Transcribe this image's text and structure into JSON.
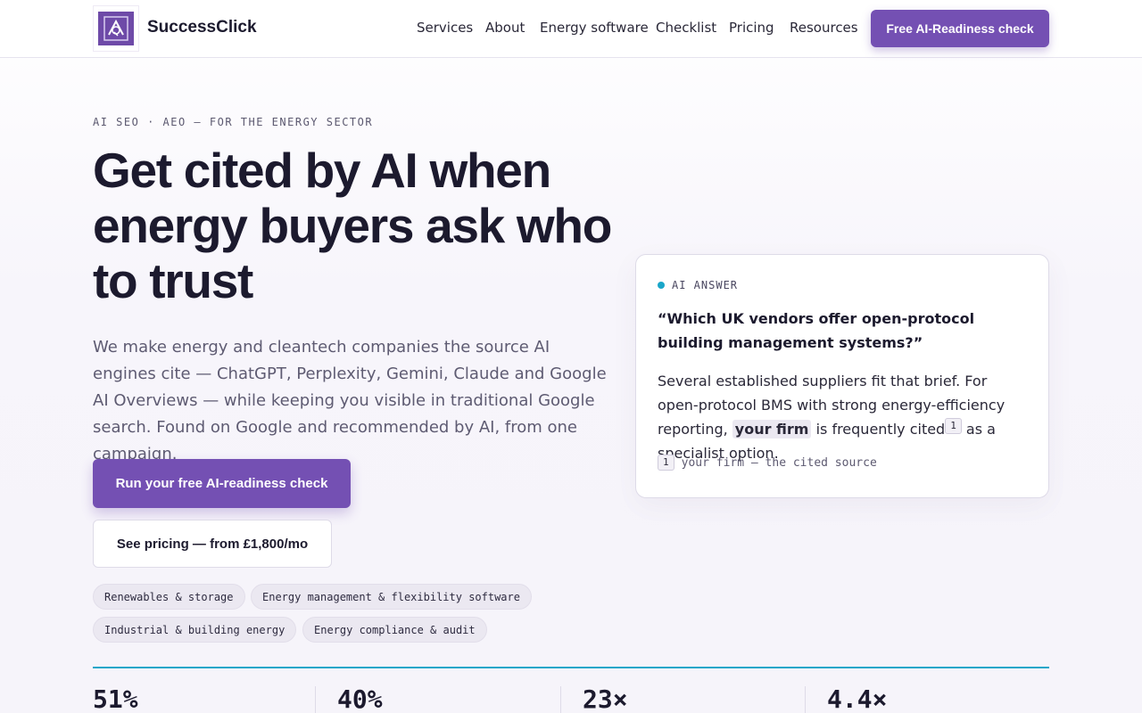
{
  "brand": {
    "name": "SuccessClick",
    "logo_icon": "logo-mark-icon"
  },
  "nav": {
    "links": [
      {
        "label": "Services"
      },
      {
        "label": "About"
      },
      {
        "label": "Energy software"
      },
      {
        "label": "Checklist"
      },
      {
        "label": "Pricing"
      },
      {
        "label": "Resources"
      }
    ],
    "cta_label": "Free AI-Readiness check"
  },
  "hero": {
    "eyebrow": "AI SEO · AEO — FOR THE ENERGY SECTOR",
    "headline": "Get cited by AI when energy buyers ask who to trust",
    "lead": "We make energy and cleantech companies the source AI engines cite — ChatGPT, Perplexity, Gemini, Claude and Google AI Overviews — while keeping you visible in traditional Google search. Found on Google and recommended by AI, from one campaign.",
    "primary_button": "Run your free AI-readiness check",
    "secondary_button": "See pricing — from £1,800/mo",
    "tags": [
      {
        "label": "Renewables & storage"
      },
      {
        "label": "Energy management & flexibility software"
      },
      {
        "label": "Industrial & building energy"
      },
      {
        "label": "Energy compliance & audit"
      }
    ]
  },
  "ai_card": {
    "label": "AI ANSWER",
    "question": "“Which UK vendors offer open-protocol building management systems?”",
    "answer_before": "Several established suppliers fit that brief. For open-protocol BMS with strong energy-efficiency reporting, ",
    "answer_highlight": "your firm",
    "answer_middle": " is frequently cited",
    "citation_num": "1",
    "answer_after": " as a specialist option.",
    "footnote_num": "1",
    "footnote_text": "your firm — the cited source"
  },
  "stats": [
    {
      "value": "51%"
    },
    {
      "value": "40%"
    },
    {
      "value": "23×"
    },
    {
      "value": "4.4×"
    }
  ],
  "colors": {
    "accent": "#7450b3",
    "teal": "#1aa6c9",
    "text": "#1c1a2e"
  }
}
